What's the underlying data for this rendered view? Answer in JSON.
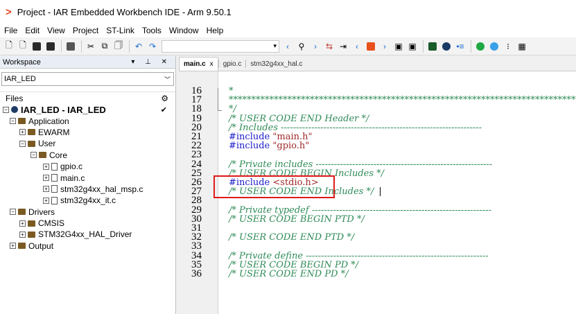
{
  "window": {
    "title": "Project - IAR Embedded Workbench IDE - Arm 9.50.1",
    "logo": ">"
  },
  "menu": [
    "File",
    "Edit",
    "View",
    "Project",
    "ST-Link",
    "Tools",
    "Window",
    "Help"
  ],
  "workspace": {
    "header": "Workspace",
    "controls": "▾ ⊥ ✕",
    "config": "IAR_LED",
    "files_label": "Files",
    "tree": [
      {
        "label": "IAR_LED - IAR_LED",
        "depth": 0,
        "kind": "root",
        "toggle": "⊟"
      },
      {
        "label": "Application",
        "depth": 1,
        "kind": "folder",
        "toggle": "⊟"
      },
      {
        "label": "EWARM",
        "depth": 2,
        "kind": "folder",
        "toggle": "⊞"
      },
      {
        "label": "User",
        "depth": 2,
        "kind": "folder",
        "toggle": "⊟"
      },
      {
        "label": "Core",
        "depth": 3,
        "kind": "folder",
        "toggle": "⊟"
      },
      {
        "label": "gpio.c",
        "depth": 4,
        "kind": "file",
        "toggle": "⊞"
      },
      {
        "label": "main.c",
        "depth": 4,
        "kind": "file",
        "toggle": "⊞"
      },
      {
        "label": "stm32g4xx_hal_msp.c",
        "depth": 4,
        "kind": "file",
        "toggle": "⊞"
      },
      {
        "label": "stm32g4xx_it.c",
        "depth": 4,
        "kind": "file",
        "toggle": "⊞"
      },
      {
        "label": "Drivers",
        "depth": 1,
        "kind": "folder",
        "toggle": "⊟"
      },
      {
        "label": "CMSIS",
        "depth": 2,
        "kind": "folder",
        "toggle": "⊞"
      },
      {
        "label": "STM32G4xx_HAL_Driver",
        "depth": 2,
        "kind": "folder",
        "toggle": "⊞"
      },
      {
        "label": "Output",
        "depth": 1,
        "kind": "folder",
        "toggle": "⊞"
      }
    ]
  },
  "editor": {
    "tabs": [
      {
        "label": "main.c",
        "active": true,
        "close": "x"
      },
      {
        "label": "gpio.c",
        "active": false
      },
      {
        "label": "stm32g4xx_hal.c",
        "active": false
      }
    ],
    "lines": [
      {
        "n": "16",
        "parts": [
          {
            "t": "*",
            "c": "cm"
          }
        ]
      },
      {
        "n": "17",
        "parts": [
          {
            "t": "******************************************************************************",
            "c": "cm"
          }
        ]
      },
      {
        "n": "18",
        "parts": [
          {
            "t": "*/",
            "c": "cm"
          }
        ]
      },
      {
        "n": "19",
        "parts": [
          {
            "t": "/* USER CODE END Header */",
            "c": "cm"
          }
        ]
      },
      {
        "n": "20",
        "parts": [
          {
            "t": "/* Includes ------------------------------------------------------------------",
            "c": "cm"
          }
        ]
      },
      {
        "n": "21",
        "parts": [
          {
            "t": "#include ",
            "c": "kw"
          },
          {
            "t": "\"main.h\"",
            "c": "str"
          }
        ]
      },
      {
        "n": "22",
        "parts": [
          {
            "t": "#include ",
            "c": "kw"
          },
          {
            "t": "\"gpio.h\"",
            "c": "str"
          }
        ]
      },
      {
        "n": "23",
        "parts": []
      },
      {
        "n": "24",
        "parts": [
          {
            "t": "/* Private includes ----------------------------------------------------------",
            "c": "cm"
          }
        ]
      },
      {
        "n": "25",
        "parts": [
          {
            "t": "/* USER CODE BEGIN Includes */",
            "c": "cm"
          }
        ]
      },
      {
        "n": "26",
        "parts": [
          {
            "t": "#include ",
            "c": "kw"
          },
          {
            "t": "<stdio.h>",
            "c": "str"
          }
        ]
      },
      {
        "n": "27",
        "parts": [
          {
            "t": "/* USER CODE END Includes */",
            "c": "cm"
          }
        ]
      },
      {
        "n": "28",
        "parts": []
      },
      {
        "n": "29",
        "parts": [
          {
            "t": "/* Private typedef -----------------------------------------------------------",
            "c": "cm"
          }
        ]
      },
      {
        "n": "30",
        "parts": [
          {
            "t": "/* USER CODE BEGIN PTD */",
            "c": "cm"
          }
        ]
      },
      {
        "n": "31",
        "parts": []
      },
      {
        "n": "32",
        "parts": [
          {
            "t": "/* USER CODE END PTD */",
            "c": "cm"
          }
        ]
      },
      {
        "n": "33",
        "parts": []
      },
      {
        "n": "34",
        "parts": [
          {
            "t": "/* Private define ------------------------------------------------------------",
            "c": "cm"
          }
        ]
      },
      {
        "n": "35",
        "parts": [
          {
            "t": "/* USER CODE BEGIN PD */",
            "c": "cm"
          }
        ]
      },
      {
        "n": "36",
        "parts": [
          {
            "t": "/* USER CODE END PD */",
            "c": "cm"
          }
        ]
      }
    ]
  },
  "colors": {
    "comment": "#2e8b57",
    "keyword": "#1a1acc",
    "string": "#a0282a",
    "highlight_box": "#e01818",
    "logo": "#e8401c"
  }
}
